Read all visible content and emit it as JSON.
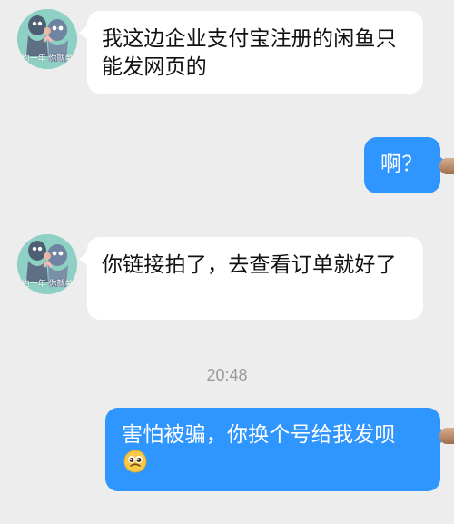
{
  "avatar": {
    "caption": "约一年 你就单"
  },
  "messages": [
    {
      "side": "left",
      "text": "我这边企业支付宝注册的闲鱼只能发网页的"
    },
    {
      "side": "right",
      "text": "啊？"
    },
    {
      "side": "left",
      "text": "你链接拍了，去查看订单就好了"
    },
    {
      "side": "time",
      "text": "20:48"
    },
    {
      "side": "right",
      "text": "害怕被骗，你换个号给我发呗",
      "emoji": "pleading-face-emoji"
    }
  ],
  "colors": {
    "background": "#ededed",
    "incoming_bubble": "#ffffff",
    "outgoing_bubble": "#2f95ff",
    "outgoing_text": "#ffffff",
    "incoming_text": "#111111",
    "timestamp": "#9a9a9a"
  },
  "icons": {
    "contact_avatar": "cartoon-cat-avatar-icon",
    "self_avatar": "self-avatar-icon",
    "emoji": "pleading-face-emoji"
  }
}
